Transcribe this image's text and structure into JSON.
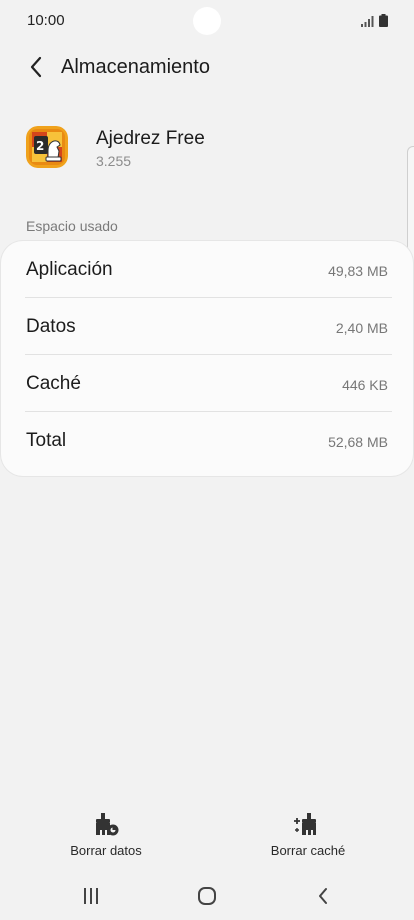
{
  "status_bar": {
    "time": "10:00"
  },
  "header": {
    "back_icon": "chevron-left-icon",
    "title": "Almacenamiento"
  },
  "app": {
    "name": "Ajedrez Free",
    "version": "3.255",
    "icon": "chess-app-icon"
  },
  "section": {
    "label": "Espacio usado"
  },
  "storage": {
    "rows": [
      {
        "label": "Aplicación",
        "value": "49,83 MB"
      },
      {
        "label": "Datos",
        "value": "2,40 MB"
      },
      {
        "label": "Caché",
        "value": "446 KB"
      },
      {
        "label": "Total",
        "value": "52,68 MB"
      }
    ]
  },
  "actions": {
    "clear_data": {
      "label": "Borrar datos",
      "icon": "clear-data-icon"
    },
    "clear_cache": {
      "label": "Borrar caché",
      "icon": "clear-cache-icon"
    }
  },
  "nav": {
    "recents_icon": "recents-icon",
    "home_icon": "home-icon",
    "back_icon": "back-icon"
  },
  "colors": {
    "background": "#f2f2f2",
    "card": "#fbfbfb",
    "text_primary": "#1c1c1c",
    "text_secondary": "#777777"
  }
}
